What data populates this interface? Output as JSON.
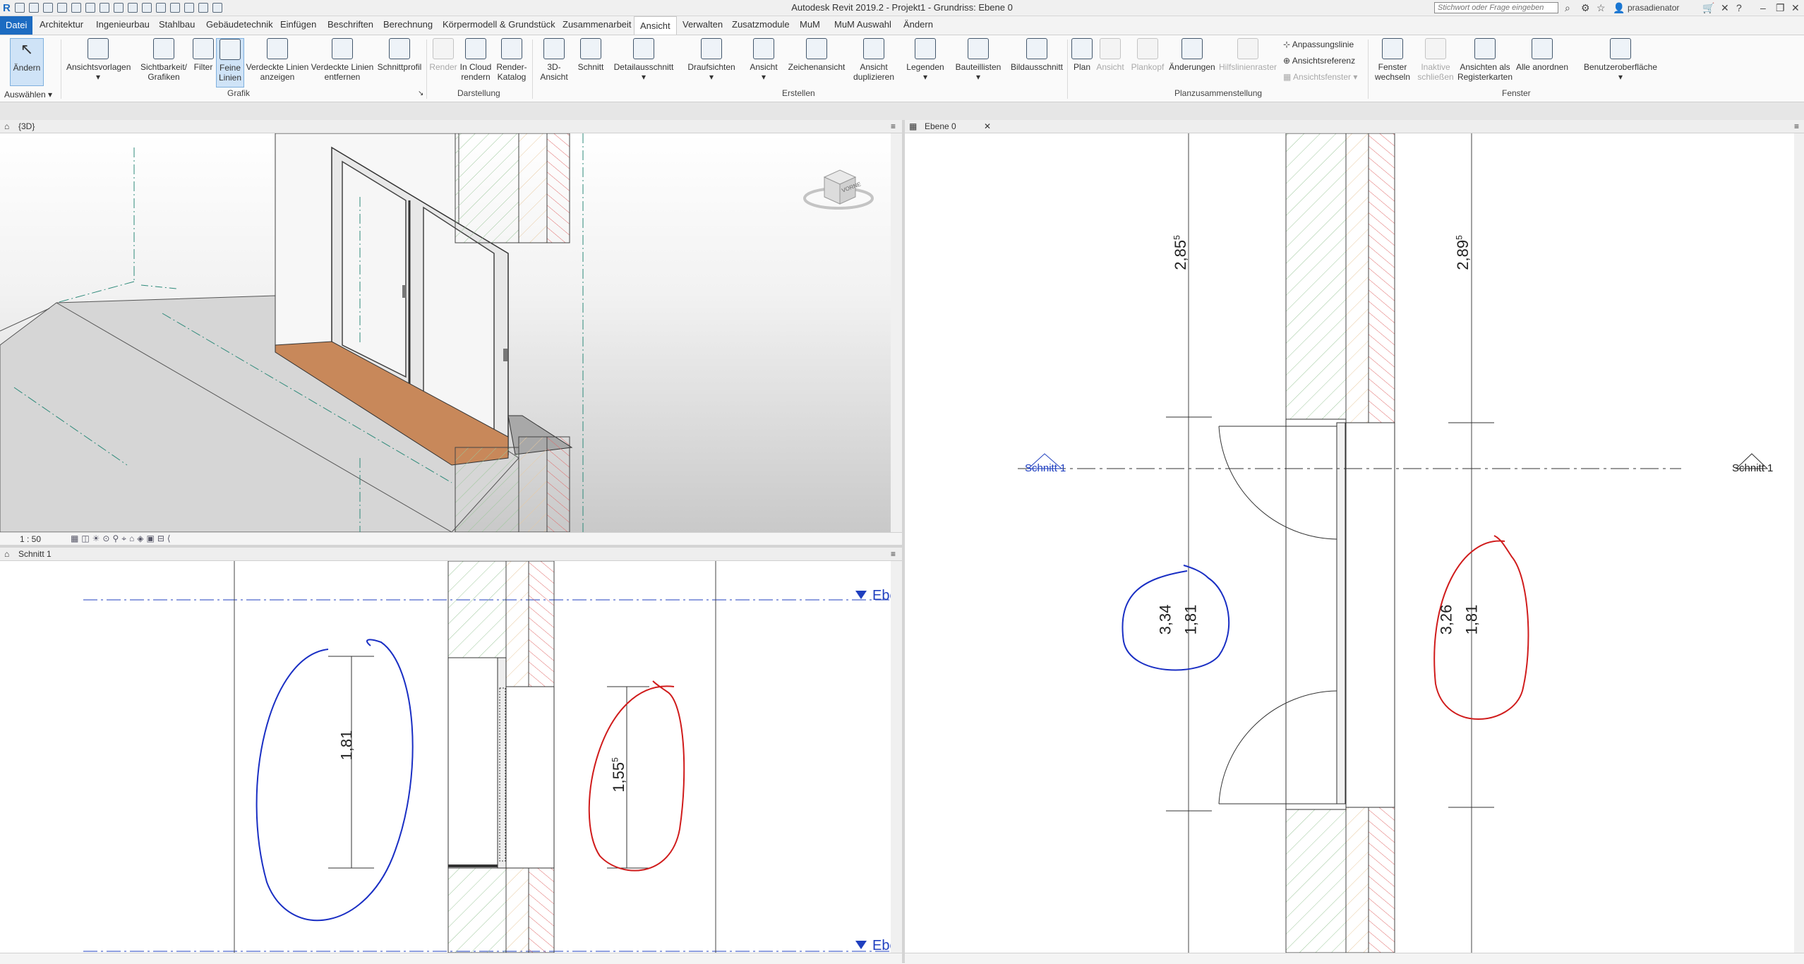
{
  "title_bar": {
    "title": "Autodesk Revit 2019.2 - Projekt1 - Grundriss: Ebene 0",
    "search_placeholder": "Stichwort oder Frage eingeben",
    "username": "prasadienator",
    "app_icon": "revit-logo-icon"
  },
  "tabs": [
    "Datei",
    "Architektur",
    "Ingenieurbau",
    "Stahlbau",
    "Gebäudetechnik",
    "Einfügen",
    "Beschriften",
    "Berechnung",
    "Körpermodell & Grundstück",
    "Zusammenarbeit",
    "Ansicht",
    "Verwalten",
    "Zusatzmodule",
    "MuM",
    "MuM Auswahl",
    "Ändern"
  ],
  "active_tab": "Ansicht",
  "ribbon": {
    "aendern": "Ändern",
    "auswaehlen": "Auswählen",
    "ansichtsvorlagen": "Ansichtsvorlagen",
    "sichtbarkeit_1": "Sichtbarkeit/",
    "sichtbarkeit_2": "Grafiken",
    "filter": "Filter",
    "feine_1": "Feine",
    "feine_2": "Linien",
    "verdeckte_anz_1": "Verdeckte Linien",
    "verdeckte_anz_2": "anzeigen",
    "verdeckte_entf_1": "Verdeckte Linien",
    "verdeckte_entf_2": "entfernen",
    "schnittprofil": "Schnittprofil",
    "render": "Render",
    "cloud_1": "In Cloud",
    "cloud_2": "rendern",
    "renderkatalog_1": "Render-",
    "renderkatalog_2": "Katalog",
    "ansicht3d_1": "3D-",
    "ansicht3d_2": "Ansicht",
    "schnitt": "Schnitt",
    "detailausschnitt": "Detailausschnitt",
    "draufsichten": "Draufsichten",
    "ansicht": "Ansicht",
    "zeichenansicht": "Zeichenansicht",
    "duplizieren_1": "Ansicht",
    "duplizieren_2": "duplizieren",
    "legenden": "Legenden",
    "bauteillisten": "Bauteillisten",
    "bildausschnitt": "Bildausschnitt",
    "plan": "Plan",
    "ansicht_dis": "Ansicht",
    "plankopf": "Plankopf",
    "aenderungen": "Änderungen",
    "hilfslinienraster": "Hilfslinienraster",
    "anpassungslinie": "Anpassungslinie",
    "ansichtsreferenz": "Ansichtsreferenz",
    "ansichtsfenster": "Ansichtsfenster",
    "fenster_wechseln_1": "Fenster",
    "fenster_wechseln_2": "wechseln",
    "inaktive_1": "Inaktive",
    "inaktive_2": "schließen",
    "registerkarten_1": "Ansichten als",
    "registerkarten_2": "Registerkarten",
    "alle_anordnen": "Alle anordnen",
    "benutzeroberflaeche": "Benutzeroberfläche",
    "groups": {
      "grafik": "Grafik",
      "darstellung": "Darstellung",
      "erstellen": "Erstellen",
      "planzusammenstellung": "Planzusammenstellung",
      "fenster": "Fenster"
    }
  },
  "views": {
    "view3d": {
      "label": "{3D}",
      "scale": "1 : 50",
      "viewcube_label": "VORNE"
    },
    "section": {
      "label": "Schnitt 1",
      "level_label": "Ebe",
      "dim_left": "1,81",
      "dim_right": "1,55",
      "dim_right_sup": "5"
    },
    "plan": {
      "label": "Ebene 0",
      "section_tag": "Schnitt 1",
      "dim_top_left": "2,85",
      "dim_top_left_sup": "5",
      "dim_top_right": "2,89",
      "dim_top_right_sup": "5",
      "dim_left_a": "3,34",
      "dim_left_b": "1,81",
      "dim_right_a": "3,26",
      "dim_right_b": "1,81"
    }
  },
  "colors": {
    "accent": "#1c6bc1",
    "annotation_blue": "#1a2fc4",
    "annotation_red": "#d01c1c",
    "sill": "#c8885a",
    "hatch_green": "#9cc79a",
    "hatch_red": "#e06868",
    "level_blue": "#1f3fbf"
  }
}
